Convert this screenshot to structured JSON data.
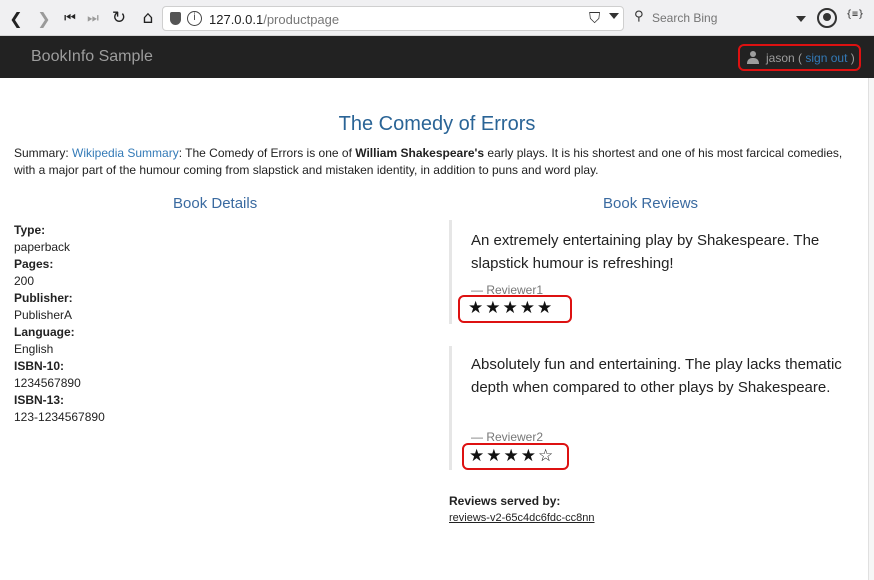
{
  "browser": {
    "url_host": "127.0.0.1",
    "url_path": "/productpage",
    "search_placeholder": "Search Bing",
    "ext_label": "{≡}",
    "icons": [
      "back-icon",
      "forward-icon",
      "first-page-icon",
      "last-page-icon",
      "reload-icon",
      "home-icon",
      "shield-icon",
      "info-icon",
      "bookmark-icon",
      "search-icon",
      "account-icon"
    ]
  },
  "navbar": {
    "brand": "BookInfo Sample",
    "user": "jason",
    "open_paren": "(",
    "signout": "sign out",
    "close_paren": ")"
  },
  "page": {
    "title": "The Comedy of Errors",
    "summary_label": "Summary: ",
    "summary_link": "Wikipedia Summary",
    "summary_pre": ": The Comedy of Errors is one of ",
    "summary_bold": "William Shakespeare's",
    "summary_post": " early plays. It is his shortest and one of his most farcical comedies, with a major part of the humour coming from slapstick and mistaken identity, in addition to puns and word play."
  },
  "details": {
    "heading": "Book Details",
    "items": [
      {
        "label": "Type:",
        "value": "paperback"
      },
      {
        "label": "Pages:",
        "value": "200"
      },
      {
        "label": "Publisher:",
        "value": "PublisherA"
      },
      {
        "label": "Language:",
        "value": "English"
      },
      {
        "label": "ISBN-10:",
        "value": "1234567890"
      },
      {
        "label": "ISBN-13:",
        "value": "123-1234567890"
      }
    ]
  },
  "reviews": {
    "heading": "Book Reviews",
    "items": [
      {
        "text": "An extremely entertaining play by Shakespeare. The slapstick humour is refreshing!",
        "reviewer": "— Reviewer1",
        "stars": "★★★★★",
        "rating": 5
      },
      {
        "text": "Absolutely fun and entertaining. The play lacks thematic depth when compared to other plays by Shakespeare.",
        "reviewer": "— Reviewer2",
        "stars": "★★★★☆",
        "rating": 4
      }
    ],
    "served_label": "Reviews served by:",
    "served_value": "reviews-v2-65c4dc6fdc-cc8nn"
  },
  "colors": {
    "navbar_bg": "#222222",
    "link": "#337ab7",
    "heading": "#2a6496",
    "highlight": "#dd1111"
  }
}
